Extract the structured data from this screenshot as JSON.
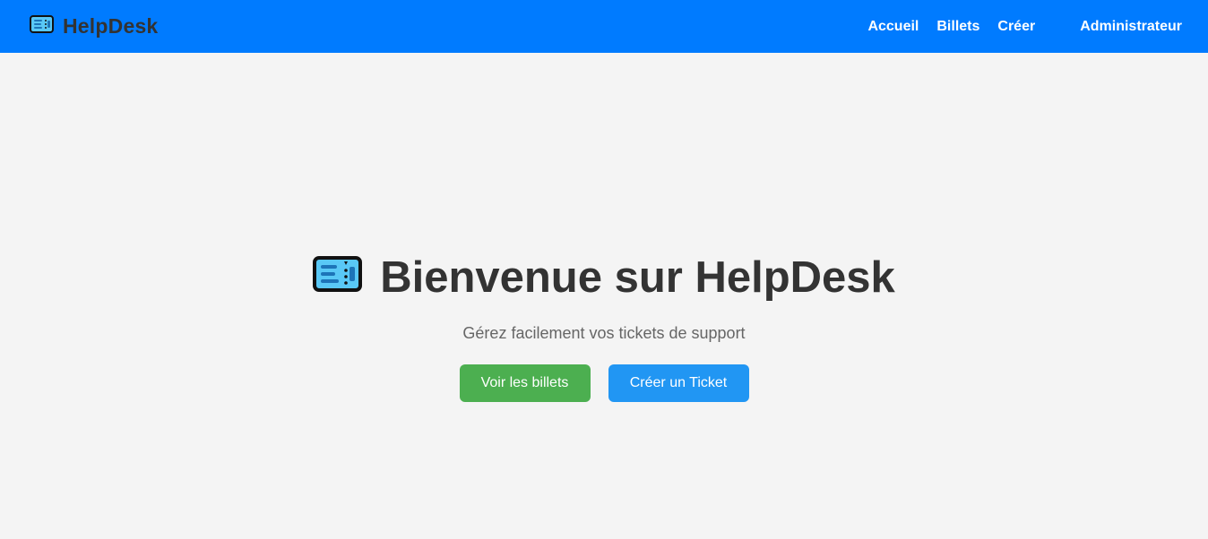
{
  "app": {
    "brand_name": "HelpDesk",
    "brand_icon": "ticket-icon"
  },
  "nav": {
    "items": [
      {
        "label": "Accueil"
      },
      {
        "label": "Billets"
      },
      {
        "label": "Créer"
      },
      {
        "label": "Administrateur"
      }
    ]
  },
  "hero": {
    "title": "Bienvenue sur HelpDesk",
    "icon": "ticket-icon",
    "subtitle": "Gérez facilement vos tickets de support",
    "buttons": {
      "view_tickets": "Voir les billets",
      "create_ticket": "Créer un Ticket"
    }
  },
  "colors": {
    "navbar": "#007bff",
    "background": "#f4f4f4",
    "primary_text": "#333333",
    "secondary_text": "#666666",
    "view_button": "#4caf50",
    "create_button": "#2196f3",
    "ticket_fill": "#59c8f6"
  }
}
